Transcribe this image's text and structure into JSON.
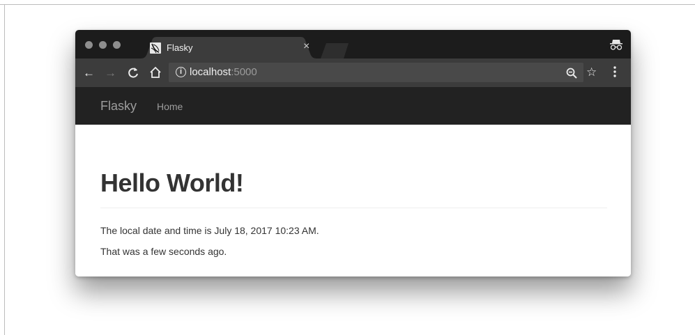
{
  "browser": {
    "tab": {
      "title": "Flasky",
      "close_glyph": "×"
    },
    "toolbar": {
      "back_glyph": "←",
      "forward_glyph": "→",
      "reload_glyph": "C",
      "home_glyph": "⌂",
      "star_glyph": "☆",
      "address": {
        "host": "localhost",
        "port": ":5000"
      }
    }
  },
  "navbar": {
    "brand": "Flasky",
    "links": [
      "Home"
    ]
  },
  "page": {
    "heading": "Hello World!",
    "datetime_text": "The local date and time is July 18, 2017 10:23 AM.",
    "relative_text": "That was a few seconds ago."
  },
  "icons": {
    "info": "i",
    "zoom": "zoom-icon",
    "incognito": "incognito-icon",
    "menu": "three-dots-menu-icon"
  },
  "colors": {
    "titlebar": "#1c1c1c",
    "toolbar": "#3c3c3c",
    "navbar": "#222222",
    "nav_text": "#9d9d9d",
    "heading_text": "#333333"
  }
}
